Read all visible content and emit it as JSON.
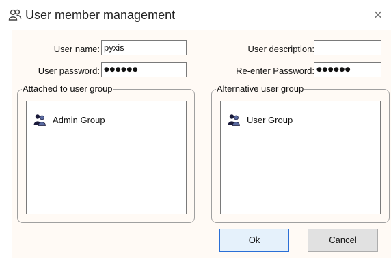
{
  "window": {
    "title": "User member management",
    "icon": "users-icon",
    "close_glyph": "×"
  },
  "form": {
    "user_name_label": "User name:",
    "user_name_value": "pyxis",
    "user_description_label": "User description:",
    "user_description_value": "",
    "user_password_label": "User password:",
    "user_password_value": "●●●●●●",
    "reenter_password_label": "Re-enter Password:",
    "reenter_password_value": "●●●●●●"
  },
  "attached_group": {
    "legend": "Attached to user group",
    "items": [
      {
        "label": "Admin Group",
        "icon": "user-group-icon"
      }
    ]
  },
  "alternative_group": {
    "legend": "Alternative user group",
    "items": [
      {
        "label": "User Group",
        "icon": "user-group-icon"
      }
    ]
  },
  "buttons": {
    "ok": "Ok",
    "cancel": "Cancel"
  },
  "colors": {
    "background": "#fffaf5",
    "default_button_border": "#2a6fd6",
    "group_icon_dark": "#1a1a3a",
    "group_icon_light": "#5a6aa0"
  }
}
